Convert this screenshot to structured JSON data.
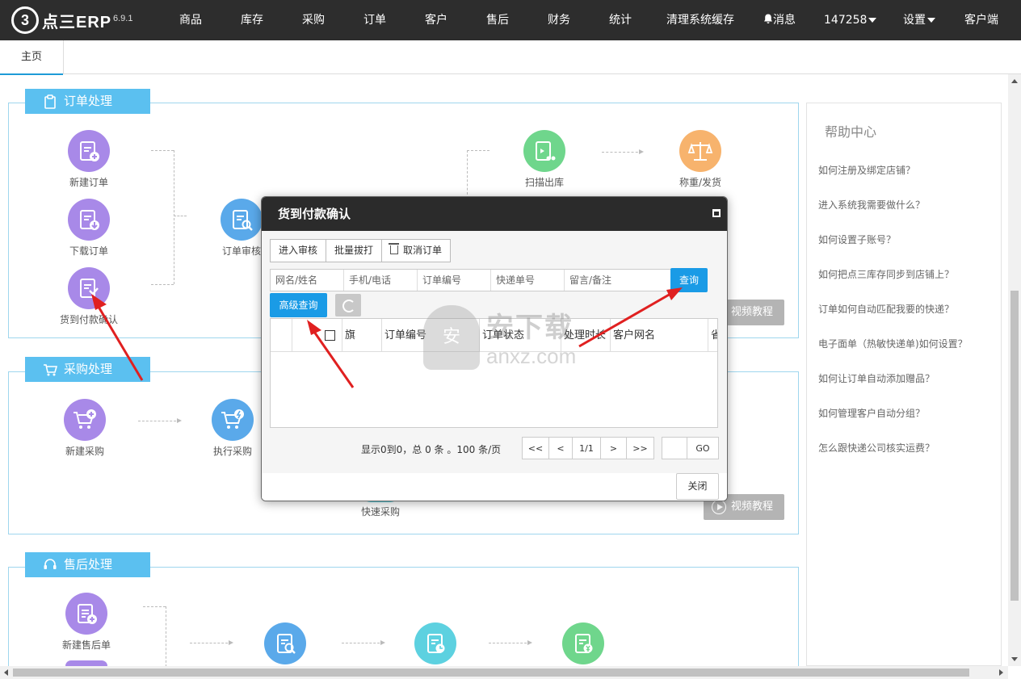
{
  "app": {
    "logo_mark": "3",
    "logo_text": "点三ERP",
    "version": "6.9.1"
  },
  "nav": {
    "items": [
      "商品",
      "库存",
      "采购",
      "订单",
      "客户",
      "售后",
      "财务",
      "统计",
      "清理系统缓存"
    ],
    "messages": "消息",
    "user": "147258",
    "settings": "设置",
    "client": "客户端"
  },
  "tabs": {
    "home": "主页"
  },
  "sections": {
    "order": {
      "title": "订单处理",
      "nodes": [
        "新建订单",
        "下载订单",
        "货到付款确认",
        "订单审核",
        "扫描出库",
        "称重/发货"
      ],
      "video": "视频教程"
    },
    "purchase": {
      "title": "采购处理",
      "nodes": [
        "新建采购",
        "执行采购",
        "快速采购"
      ],
      "video": "视频教程"
    },
    "aftersale": {
      "title": "售后处理",
      "nodes": [
        "新建售后单"
      ]
    }
  },
  "help": {
    "title": "帮助中心",
    "links": [
      "如何注册及绑定店铺？",
      "进入系统我需要做什么？",
      "如何设置子账号？",
      "如何把点三库存同步到店铺上？",
      "订单如何自动匹配我要的快递？",
      "电子面单（热敏快递单)如何设置？",
      "如何让订单自动添加赠品？",
      "如何管理客户自动分组？",
      "怎么跟快递公司核实运费？"
    ]
  },
  "watermark": {
    "shield": "安",
    "title": "安下载",
    "domain": "anxz.com"
  },
  "modal": {
    "title": "货到付款确认",
    "toolbar": {
      "review": "进入审核",
      "batch_print": "批量拔打",
      "cancel_order": "取消订单"
    },
    "search": {
      "placeholders": [
        "网名/姓名",
        "手机/电话",
        "订单编号",
        "快递单号",
        "留言/备注"
      ],
      "query": "查询",
      "advanced": "高级查询"
    },
    "columns": [
      "旗",
      "订单编号",
      "订单状态",
      "处理时长",
      "客户网名",
      "省"
    ],
    "pager": {
      "info": "显示0到0，总 0 条 。100 条/页",
      "first": "<<",
      "prev": "<",
      "page": "1/1",
      "next": ">",
      "last": ">>",
      "go": "GO"
    },
    "close": "关闭"
  },
  "colors": {
    "accent": "#5bc0f0",
    "primary_button": "#1a9be6",
    "annotation": "#e02020",
    "topbar": "#2d2d2d"
  }
}
